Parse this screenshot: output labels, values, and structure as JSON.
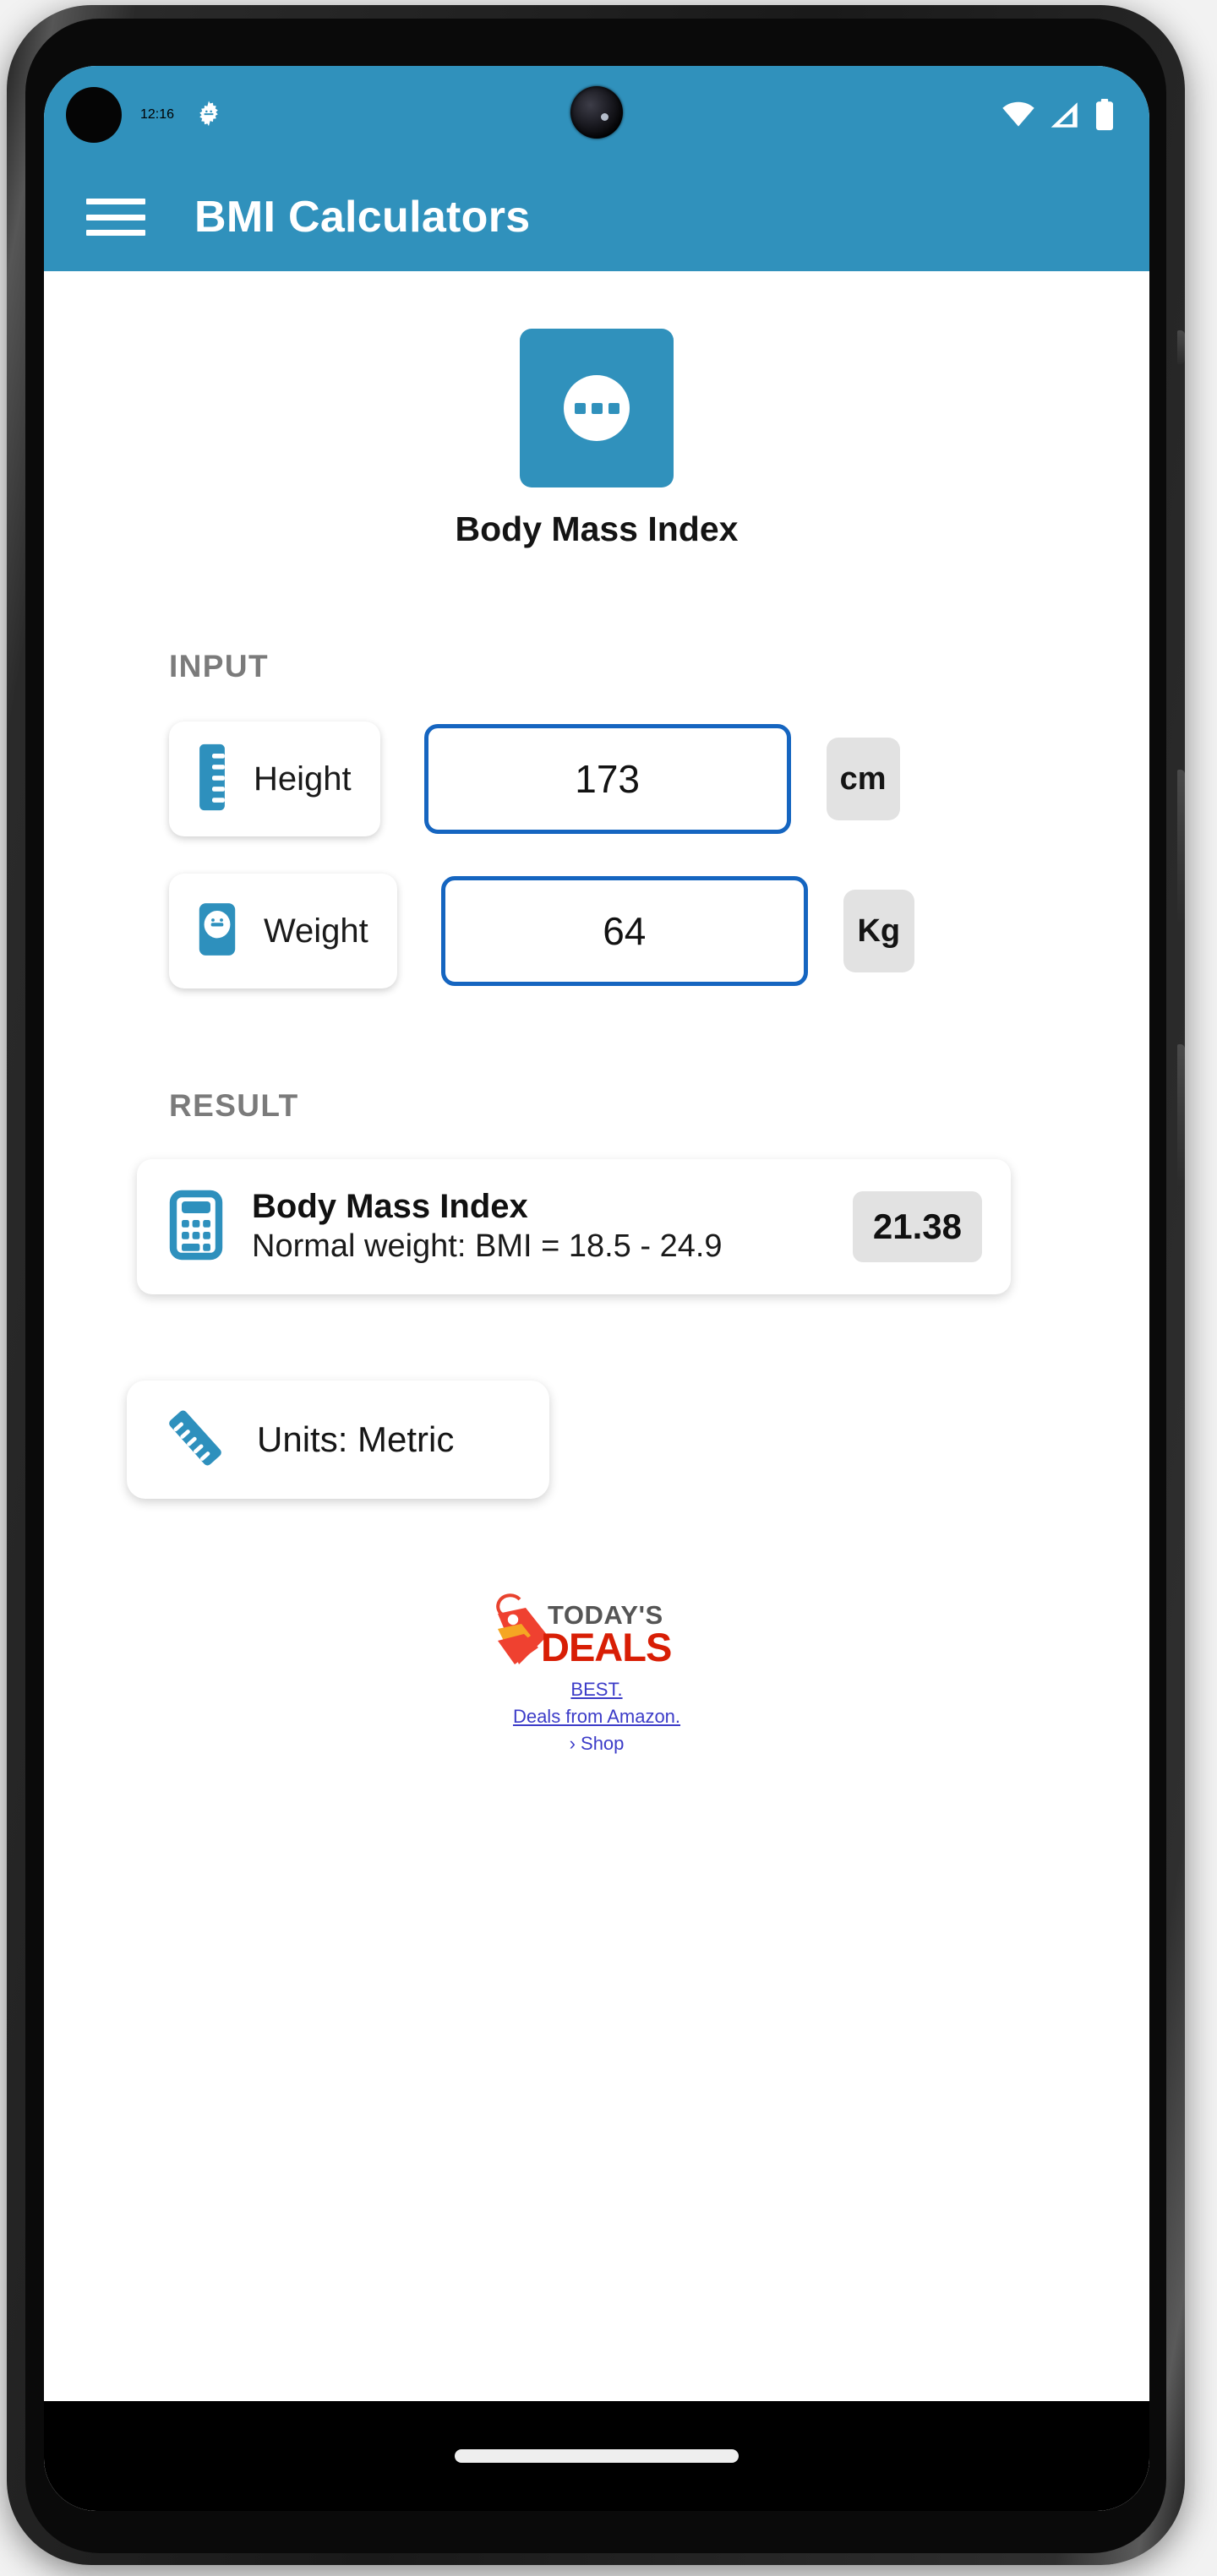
{
  "status_bar": {
    "time": "12:16",
    "icons": [
      "android-gear-icon",
      "wifi-icon",
      "cellular-signal-icon",
      "battery-icon"
    ]
  },
  "app_bar": {
    "menu_icon": "hamburger-menu-icon",
    "title": "BMI Calculators"
  },
  "header": {
    "icon": "bmi-tile-icon",
    "title": "Body Mass Index"
  },
  "input_section": {
    "label": "INPUT",
    "rows": [
      {
        "icon": "height-ruler-icon",
        "label": "Height",
        "value": "173",
        "unit": "cm"
      },
      {
        "icon": "weight-scale-icon",
        "label": "Weight",
        "value": "64",
        "unit": "Kg"
      }
    ]
  },
  "result_section": {
    "label": "RESULT",
    "card": {
      "icon": "calculator-icon",
      "title": "Body Mass Index",
      "subtitle": "Normal weight: BMI = 18.5 - 24.9",
      "value": "21.38"
    }
  },
  "units_card": {
    "icon": "ruler-icon",
    "label": "Units: Metric"
  },
  "ad": {
    "logo_top_text": "TODAY'S",
    "logo_bottom_text": "DEALS",
    "links": [
      "BEST.",
      "Deals from Amazon.",
      "› Shop"
    ]
  },
  "nav_bar": {
    "home_indicator": "home-gesture-bar"
  },
  "colors": {
    "accent": "#3091BC",
    "field_border": "#1565C0",
    "chip_bg": "#e2e2e2",
    "link": "#3c3cc8",
    "ad_red": "#d81e05",
    "ad_orange": "#f5a623",
    "ad_gray": "#555555"
  }
}
